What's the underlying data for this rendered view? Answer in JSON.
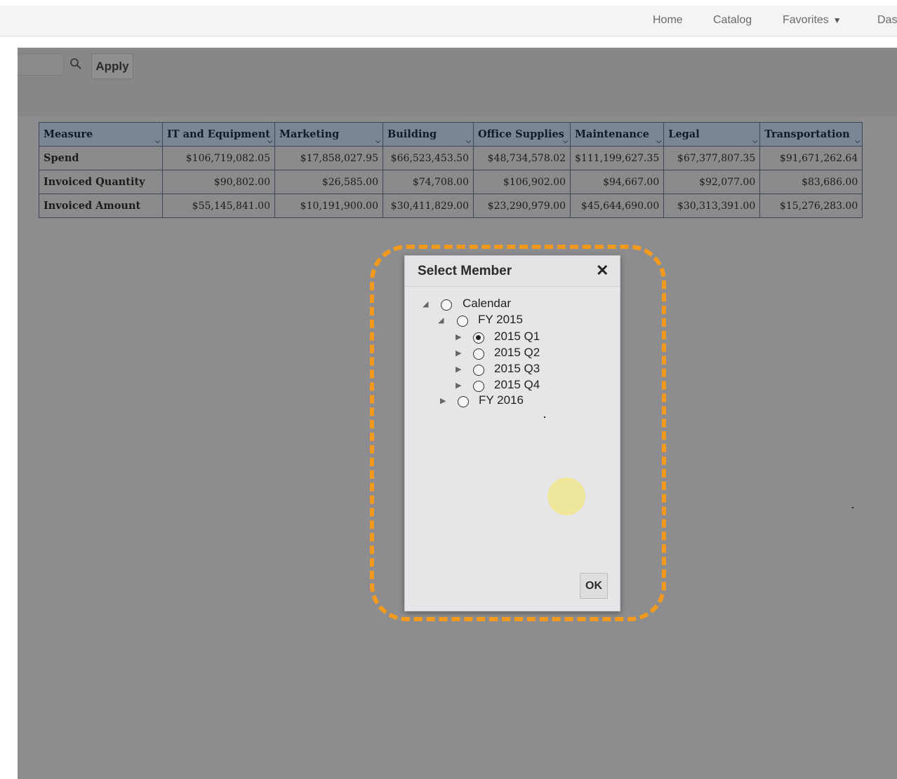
{
  "topnav": {
    "links": [
      "Home",
      "Catalog",
      "Favorites",
      "Das"
    ],
    "favorites_arrow": "▼"
  },
  "prompt": {
    "apply_label": "Apply"
  },
  "table": {
    "headers": [
      "Measure",
      "IT and Equipment",
      "Marketing",
      "Building",
      "Office Supplies",
      "Maintenance",
      "Legal",
      "Transportation"
    ],
    "rows": [
      {
        "label": "Spend",
        "values": [
          "$106,719,082.05",
          "$17,858,027.95",
          "$66,523,453.50",
          "$48,734,578.02",
          "$111,199,627.35",
          "$67,377,807.35",
          "$91,671,262.64"
        ]
      },
      {
        "label": "Invoiced Quantity",
        "values": [
          "$90,802.00",
          "$26,585.00",
          "$74,708.00",
          "$106,902.00",
          "$94,667.00",
          "$92,077.00",
          "$83,686.00"
        ]
      },
      {
        "label": "Invoiced Amount",
        "values": [
          "$55,145,841.00",
          "$10,191,900.00",
          "$30,411,829.00",
          "$23,290,979.00",
          "$45,644,690.00",
          "$30,313,391.00",
          "$15,276,283.00"
        ]
      }
    ]
  },
  "dialog": {
    "title": "Select Member",
    "close_symbol": "✕",
    "tree": [
      {
        "label": "Calendar",
        "selected": false,
        "expanded": true
      },
      {
        "label": "FY 2015",
        "selected": false,
        "expanded": true
      },
      {
        "label": "2015 Q1",
        "selected": true,
        "expanded": false
      },
      {
        "label": "2015 Q2",
        "selected": false,
        "expanded": false
      },
      {
        "label": "2015 Q3",
        "selected": false,
        "expanded": false
      },
      {
        "label": "2015 Q4",
        "selected": false,
        "expanded": false
      },
      {
        "label": "FY 2016",
        "selected": false,
        "expanded": false
      }
    ],
    "ok_label": "OK"
  },
  "colors": {
    "highlight": "#f39a1e",
    "overlay": "#8d8d8f",
    "dialog_bg": "#e6e5e8",
    "table_header": "#7a8595"
  }
}
